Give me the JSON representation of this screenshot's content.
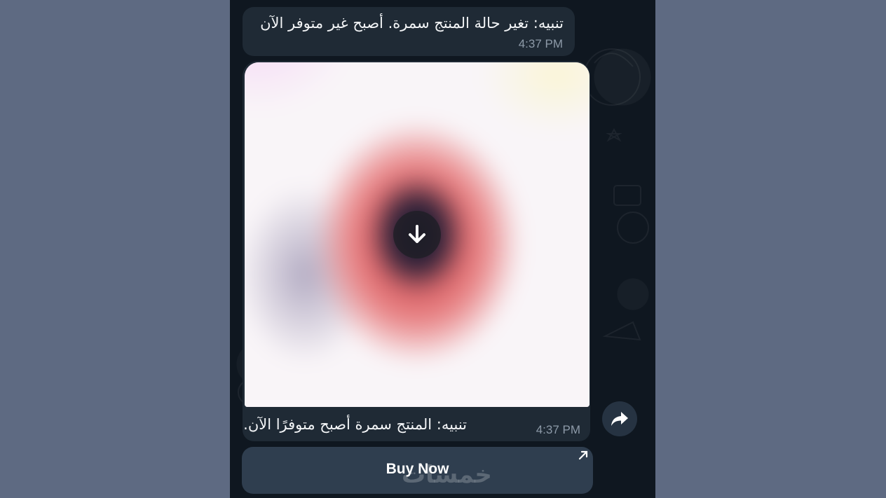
{
  "messages": {
    "first": {
      "text": "تنبيه: تغير حالة المنتج سمرة. أصبح غير متوفر الآن",
      "time": "4:37 PM"
    },
    "second": {
      "caption": "تنبيه: المنتج سمرة أصبح متوفرًا الآن.",
      "time": "4:37 PM"
    }
  },
  "buy_button": {
    "label": "Buy Now"
  },
  "watermark": "خمسات",
  "icons": {
    "download": "download-arrow-icon",
    "share": "share-forward-icon",
    "external": "external-link-arrow-icon"
  },
  "colors": {
    "page_background": "#5e6a82",
    "chat_background": "#0f1720",
    "bubble": "#1f2a35",
    "button": "#2f3e4f",
    "timestamp": "#8d9aa8"
  }
}
